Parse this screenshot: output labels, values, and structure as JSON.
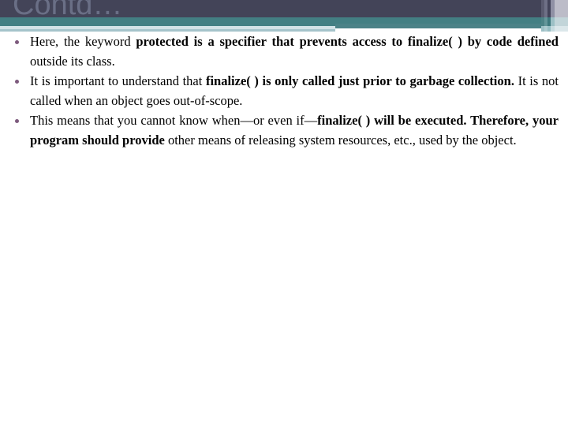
{
  "slide": {
    "title": "Contd…",
    "title_color": "#6a6f86",
    "bullet_color": "#7d5a7d",
    "band_colors": {
      "dark": "#434458",
      "teal": "#437f83",
      "light_blue": "#a5c4cb",
      "white_rule": "#ffffff"
    },
    "bullets": [
      {
        "id": "bullet-1",
        "segments": [
          {
            "text": "Here, the keyword ",
            "bold": false
          },
          {
            "text": "protected is a specifier that prevents access to finalize( ) by code defined",
            "bold": true
          },
          {
            "text": " outside its class.",
            "bold": false
          }
        ]
      },
      {
        "id": "bullet-2",
        "segments": [
          {
            "text": "It is important to understand that ",
            "bold": false
          },
          {
            "text": "finalize( ) is only called just prior to garbage collection.",
            "bold": true
          },
          {
            "text": " It is not called when an object goes out-of-scope.",
            "bold": false
          }
        ]
      },
      {
        "id": "bullet-3",
        "segments": [
          {
            "text": "This means that you cannot know when—or even if—",
            "bold": false
          },
          {
            "text": "finalize( ) will be executed. Therefore, your program should provide",
            "bold": true
          },
          {
            "text": " other means of releasing system resources, etc., used by the object.",
            "bold": false
          }
        ]
      }
    ]
  }
}
